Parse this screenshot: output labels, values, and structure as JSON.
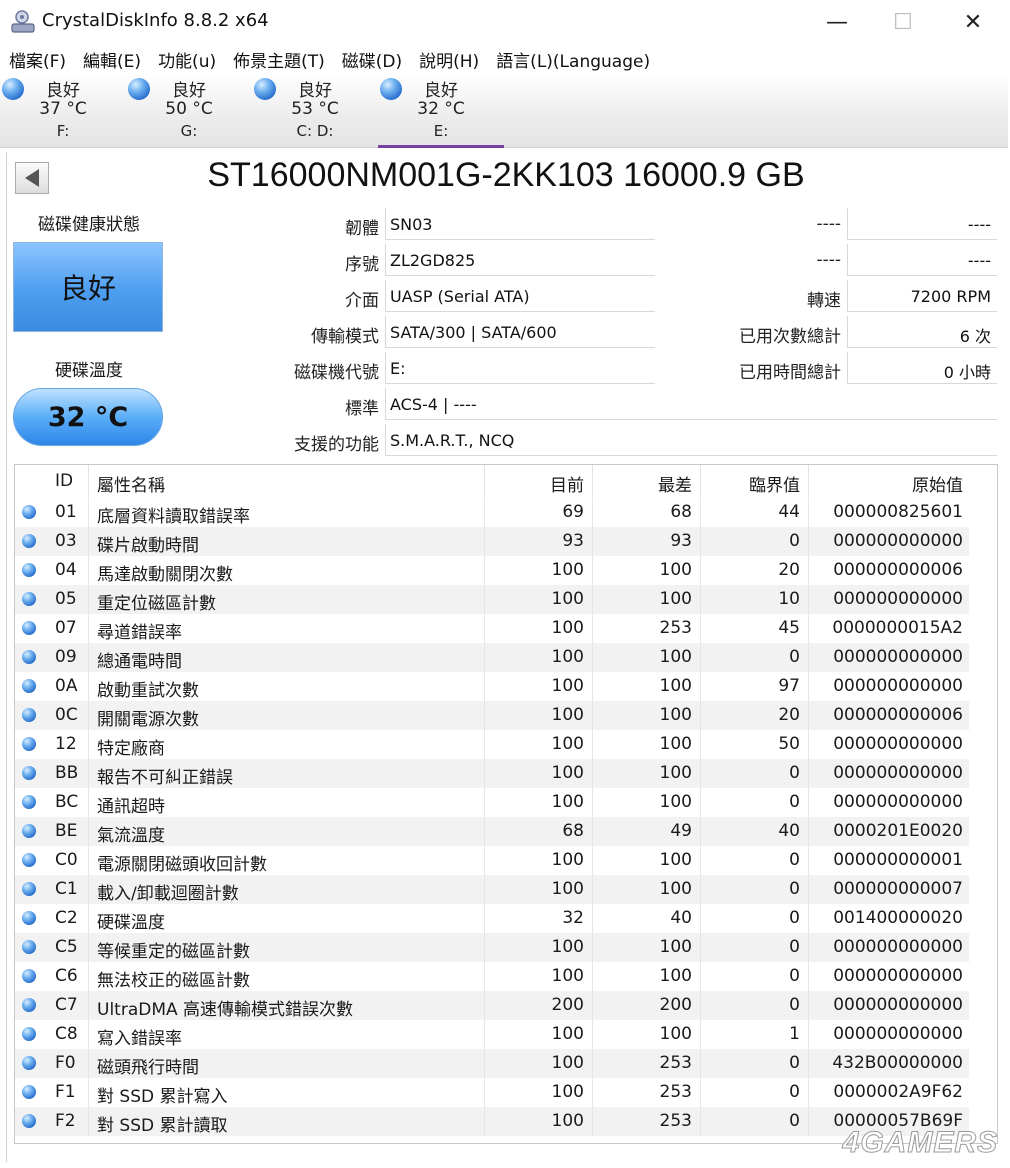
{
  "window": {
    "title": "CrystalDiskInfo 8.8.2 x64",
    "min_glyph": "—",
    "max_glyph": "☐",
    "close_glyph": "✕"
  },
  "menu": [
    "檔案(F)",
    "編輯(E)",
    "功能(u)",
    "佈景主題(T)",
    "磁碟(D)",
    "說明(H)",
    "語言(L)(Language)"
  ],
  "drives": [
    {
      "status": "良好",
      "temp": "37 °C",
      "letter": "F:",
      "active": false
    },
    {
      "status": "良好",
      "temp": "50 °C",
      "letter": "G:",
      "active": false
    },
    {
      "status": "良好",
      "temp": "53 °C",
      "letter": "C: D:",
      "active": false
    },
    {
      "status": "良好",
      "temp": "32 °C",
      "letter": "E:",
      "active": true
    }
  ],
  "disk": {
    "model": "ST16000NM001G-2KK103 16000.9 GB",
    "health_label": "磁碟健康狀態",
    "health_status": "良好",
    "temp_label": "硬碟溫度",
    "temperature": "32 °C",
    "firmware_label": "韌體",
    "firmware": "SN03",
    "serial_label": "序號",
    "serial": "ZL2GD825",
    "interface_label": "介面",
    "interface": "UASP (Serial ATA)",
    "transfer_label": "傳輸模式",
    "transfer": "SATA/300 | SATA/600",
    "letter_label": "磁碟機代號",
    "letter": "E:",
    "standard_label": "標準",
    "standard": "ACS-4 | ----",
    "features_label": "支援的功能",
    "features": "S.M.A.R.T., NCQ",
    "r1_label": "----",
    "r1_value": "----",
    "r2_label": "----",
    "r2_value": "----",
    "rotation_label": "轉速",
    "rotation": "7200 RPM",
    "power_count_label": "已用次數總計",
    "power_count": "6 次",
    "power_hours_label": "已用時間總計",
    "power_hours": "0 小時"
  },
  "smart": {
    "headers": {
      "id": "ID",
      "name": "屬性名稱",
      "current": "目前",
      "worst": "最差",
      "threshold": "臨界值",
      "raw": "原始值"
    },
    "rows": [
      {
        "id": "01",
        "name": "底層資料讀取錯誤率",
        "current": "69",
        "worst": "68",
        "threshold": "44",
        "raw": "000000825601"
      },
      {
        "id": "03",
        "name": "碟片啟動時間",
        "current": "93",
        "worst": "93",
        "threshold": "0",
        "raw": "000000000000"
      },
      {
        "id": "04",
        "name": "馬達啟動關閉次數",
        "current": "100",
        "worst": "100",
        "threshold": "20",
        "raw": "000000000006"
      },
      {
        "id": "05",
        "name": "重定位磁區計數",
        "current": "100",
        "worst": "100",
        "threshold": "10",
        "raw": "000000000000"
      },
      {
        "id": "07",
        "name": "尋道錯誤率",
        "current": "100",
        "worst": "253",
        "threshold": "45",
        "raw": "0000000015A2"
      },
      {
        "id": "09",
        "name": "總通電時間",
        "current": "100",
        "worst": "100",
        "threshold": "0",
        "raw": "000000000000"
      },
      {
        "id": "0A",
        "name": "啟動重試次數",
        "current": "100",
        "worst": "100",
        "threshold": "97",
        "raw": "000000000000"
      },
      {
        "id": "0C",
        "name": "開關電源次數",
        "current": "100",
        "worst": "100",
        "threshold": "20",
        "raw": "000000000006"
      },
      {
        "id": "12",
        "name": "特定廠商",
        "current": "100",
        "worst": "100",
        "threshold": "50",
        "raw": "000000000000"
      },
      {
        "id": "BB",
        "name": "報告不可糾正錯誤",
        "current": "100",
        "worst": "100",
        "threshold": "0",
        "raw": "000000000000"
      },
      {
        "id": "BC",
        "name": "通訊超時",
        "current": "100",
        "worst": "100",
        "threshold": "0",
        "raw": "000000000000"
      },
      {
        "id": "BE",
        "name": "氣流溫度",
        "current": "68",
        "worst": "49",
        "threshold": "40",
        "raw": "0000201E0020"
      },
      {
        "id": "C0",
        "name": "電源關閉磁頭收回計數",
        "current": "100",
        "worst": "100",
        "threshold": "0",
        "raw": "000000000001"
      },
      {
        "id": "C1",
        "name": "載入/卸載迴圈計數",
        "current": "100",
        "worst": "100",
        "threshold": "0",
        "raw": "000000000007"
      },
      {
        "id": "C2",
        "name": "硬碟溫度",
        "current": "32",
        "worst": "40",
        "threshold": "0",
        "raw": "001400000020"
      },
      {
        "id": "C5",
        "name": "等候重定的磁區計數",
        "current": "100",
        "worst": "100",
        "threshold": "0",
        "raw": "000000000000"
      },
      {
        "id": "C6",
        "name": "無法校正的磁區計數",
        "current": "100",
        "worst": "100",
        "threshold": "0",
        "raw": "000000000000"
      },
      {
        "id": "C7",
        "name": "UltraDMA 高速傳輸模式錯誤次數",
        "current": "200",
        "worst": "200",
        "threshold": "0",
        "raw": "000000000000"
      },
      {
        "id": "C8",
        "name": "寫入錯誤率",
        "current": "100",
        "worst": "100",
        "threshold": "1",
        "raw": "000000000000"
      },
      {
        "id": "F0",
        "name": "磁頭飛行時間",
        "current": "100",
        "worst": "253",
        "threshold": "0",
        "raw": "432B00000000"
      },
      {
        "id": "F1",
        "name": "對 SSD 累計寫入",
        "current": "100",
        "worst": "253",
        "threshold": "0",
        "raw": "0000002A9F62"
      },
      {
        "id": "F2",
        "name": "對 SSD 累計讀取",
        "current": "100",
        "worst": "253",
        "threshold": "0",
        "raw": "00000057B69F"
      }
    ]
  },
  "watermark": "4GAMERS",
  "colors": {
    "accent_tab": "#7b3fa0",
    "status_good": "#4d9ef0"
  }
}
